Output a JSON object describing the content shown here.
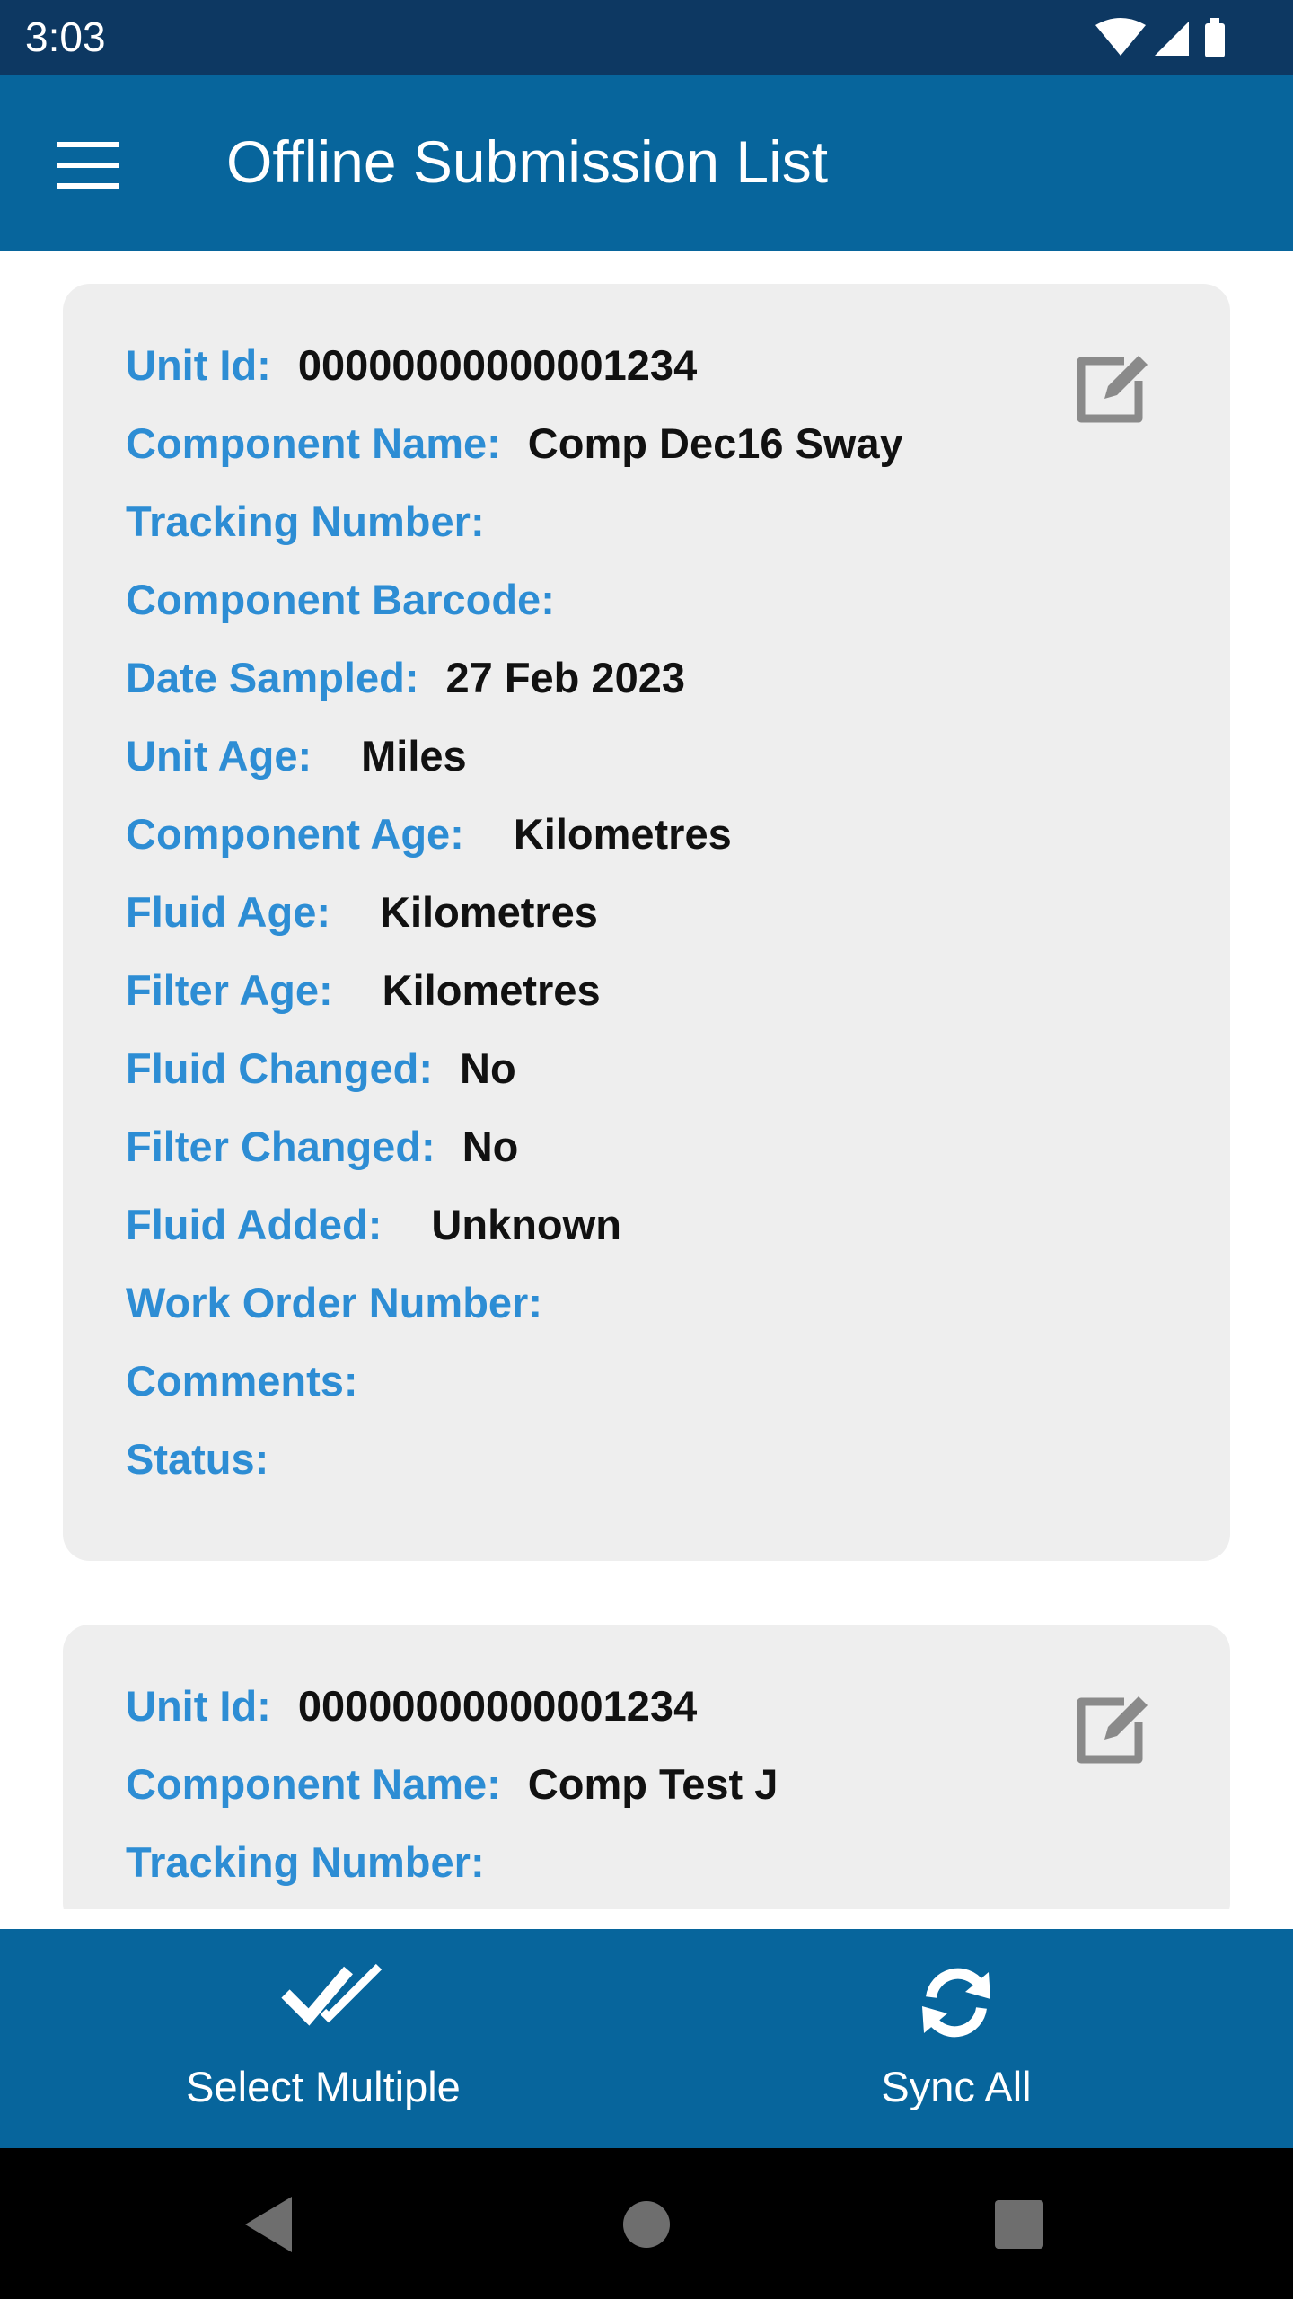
{
  "status_bar": {
    "time": "3:03"
  },
  "app_bar": {
    "title": "Offline Submission List"
  },
  "cards": [
    {
      "rows": [
        {
          "label": "Unit Id:",
          "value": "00000000000001234"
        },
        {
          "label": "Component Name:",
          "value": "Comp Dec16 Sway"
        },
        {
          "label": "Tracking Number:",
          "value": ""
        },
        {
          "label": "Component Barcode:",
          "value": ""
        },
        {
          "label": "Date Sampled:",
          "value": "27 Feb 2023"
        },
        {
          "label": "Unit Age:",
          "value": "Miles"
        },
        {
          "label": "Component Age:",
          "value": "Kilometres"
        },
        {
          "label": "Fluid Age:",
          "value": "Kilometres"
        },
        {
          "label": "Filter Age:",
          "value": "Kilometres"
        },
        {
          "label": "Fluid Changed:",
          "value": "No"
        },
        {
          "label": "Filter Changed:",
          "value": "No"
        },
        {
          "label": "Fluid Added:",
          "value": "Unknown"
        },
        {
          "label": "Work Order Number:",
          "value": ""
        },
        {
          "label": "Comments:",
          "value": ""
        },
        {
          "label": "Status:",
          "value": ""
        }
      ]
    },
    {
      "rows": [
        {
          "label": "Unit Id:",
          "value": "00000000000001234"
        },
        {
          "label": "Component Name:",
          "value": "Comp Test J"
        },
        {
          "label": "Tracking Number:",
          "value": ""
        }
      ]
    }
  ],
  "bottom_actions": {
    "select_multiple": "Select Multiple",
    "sync_all": "Sync All"
  },
  "icons": {
    "menu": "hamburger-menu-icon",
    "edit": "edit-icon",
    "select_multiple": "double-check-icon",
    "sync": "sync-icon"
  },
  "colors": {
    "status_bar": "#0d3862",
    "app_bar": "#07659c",
    "label": "#2d8dd4",
    "card_background": "#eeeeee"
  }
}
